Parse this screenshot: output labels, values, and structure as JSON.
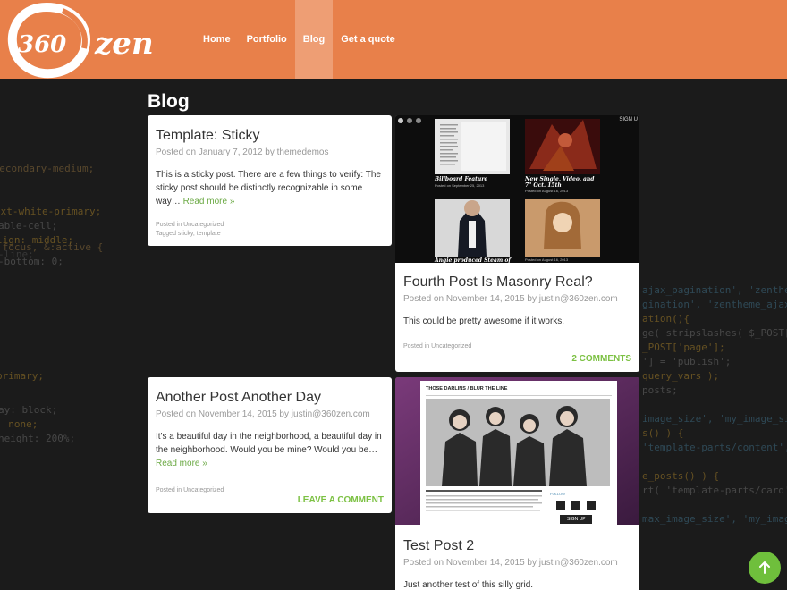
{
  "site": {
    "logo_text": "360 zen"
  },
  "nav": {
    "items": [
      {
        "label": "Home",
        "active": false
      },
      {
        "label": "Portfolio",
        "active": false
      },
      {
        "label": "Blog",
        "active": true
      },
      {
        "label": "Get a quote",
        "active": false
      }
    ]
  },
  "page": {
    "title": "Blog"
  },
  "posts": [
    {
      "title": "Template: Sticky",
      "meta_prefix": "Posted on ",
      "date": "January 7, 2012",
      "meta_by": " by ",
      "author": "themedemos",
      "excerpt": "This is a sticky post. There are a few things to verify: The sticky post should be distinctly recognizable in some way…",
      "read_more": "Read more »",
      "posted_in": "Posted in Uncategorized",
      "tagged": "Tagged sticky, template"
    },
    {
      "title": "Fourth Post Is Masonry Real?",
      "meta_prefix": "Posted on ",
      "date": "November 14, 2015",
      "meta_by": " by ",
      "author": "justin@360zen.com",
      "excerpt": "This could be pretty awesome if it works.",
      "posted_in": "Posted in Uncategorized",
      "comments": "2 Comments"
    },
    {
      "title": "Another Post Another Day",
      "meta_prefix": "Posted on ",
      "date": "November 14, 2015",
      "meta_by": " by ",
      "author": "justin@360zen.com",
      "excerpt": "It's a beautiful day in the neighborhood, a beautiful day in the neighborhood. Would you be mine? Would you be…",
      "read_more": "Read more »",
      "posted_in": "Posted in Uncategorized",
      "comments": "Leave a comment"
    },
    {
      "title": "Test Post 2",
      "meta_prefix": "Posted on ",
      "date": "November 14, 2015",
      "meta_by": " by ",
      "author": "justin@360zen.com",
      "excerpt": "Just another test of this silly grid."
    }
  ],
  "slider": {
    "captions": [
      "Billboard Feature",
      "New Single, Video, and 7\" Oct. 15th",
      "Angie produced Steam of",
      ""
    ],
    "dates": [
      "Posted on September 25, 2013",
      "Posted on August 16, 2013",
      "",
      "Posted on August 16, 2013"
    ],
    "sign_label": "SIGN U"
  },
  "band_image": {
    "header": "THOSE DARLINS / BLUR THE LINE",
    "follow_label": "FOLLOW",
    "signup_label": "SIGN UP"
  },
  "background_code": [
    "$secondary-medium;",
    "ext-white-primary;",
    "able-cell;",
    "lign: middle;",
    "-line;",
    ":focus, &:active {",
    "-bottom: 0;",
    "primary;",
    "ay: block;",
    ": none;",
    "height: 200%;",
    "ajax_pagination', 'zentheme_ajax_pagination'",
    "gination', 'zentheme_ajax_paginat",
    "ation(){",
    "ge( stripslashes( $_POST['query_v",
    "_POST['page'];",
    "'] = 'publish';",
    "query_vars );",
    "posts;",
    "image_size', 'my_image_size_over",
    "s() ) {",
    "'template-parts/content', 'none'",
    "e_posts() ) {",
    "rt( 'template-parts/card', get_p",
    "max_image_size', 'my_image_size_"
  ],
  "colors": {
    "header": "#e8804a",
    "nav_active": "#ee9e74",
    "accent_green": "#7cc143",
    "link_green": "#6ba944",
    "background": "#1b1b1b"
  },
  "icons": {
    "to_top": "arrow-up-icon"
  }
}
